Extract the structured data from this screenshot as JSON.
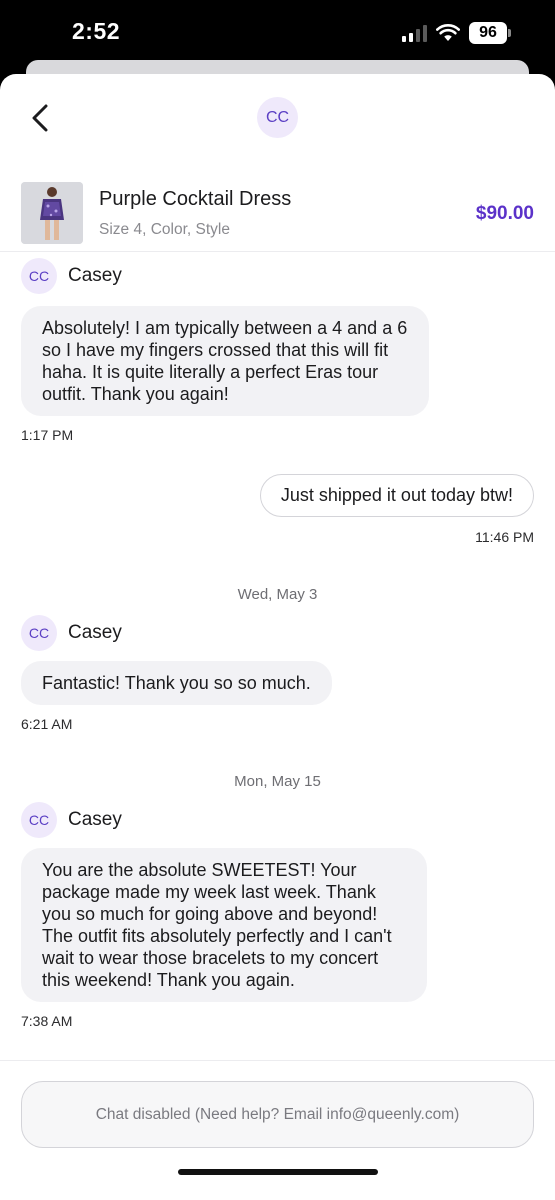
{
  "status_bar": {
    "time": "2:52",
    "battery": "96",
    "signal_bars": 2
  },
  "header": {
    "back_icon": "chevron-left-icon",
    "avatar_initials": "CC"
  },
  "product": {
    "title": "Purple Cocktail Dress",
    "subtitle": "Size 4, Color, Style",
    "price": "$90.00",
    "price_color": "#5b32c9"
  },
  "messages": {
    "m1": {
      "avatar": "CC",
      "sender": "Casey",
      "text": "Absolutely! I am typically between a 4 and a 6 so I have my fingers crossed that this will fit haha. It is quite literally a perfect Eras tour outfit. Thank you again!",
      "time": "1:17 PM"
    },
    "m2": {
      "text": "Just shipped it out today btw!",
      "time": "11:46 PM"
    },
    "day1": "Wed, May 3",
    "m3": {
      "avatar": "CC",
      "sender": "Casey",
      "text": "Fantastic! Thank you so so much.",
      "time": "6:21 AM"
    },
    "day2": "Mon, May 15",
    "m4": {
      "avatar": "CC",
      "sender": "Casey",
      "text": "You are the absolute SWEETEST! Your package made my week last week. Thank you so much for going above and beyond! The outfit fits absolutely perfectly and I can't wait to wear those bracelets to my concert this weekend! Thank you again.",
      "time": "7:38 AM"
    }
  },
  "footer": {
    "chat_disabled": "Chat disabled (Need help? Email info@queenly.com)"
  },
  "colors": {
    "accent": "#5b32c9",
    "avatar_bg": "#efe9fb",
    "bubble_in": "#f2f2f5"
  }
}
